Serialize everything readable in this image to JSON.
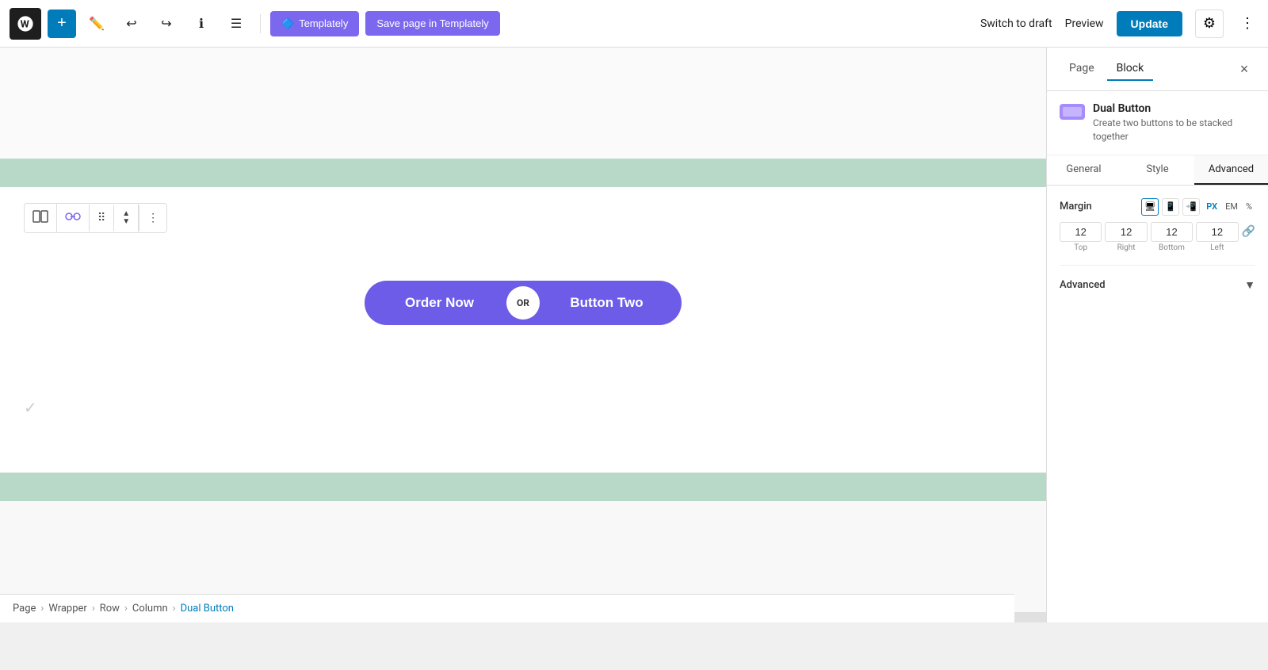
{
  "toolbar": {
    "add_label": "+",
    "templately_label": "Templately",
    "save_templately_label": "Save page in Templately",
    "switch_draft_label": "Switch to draft",
    "preview_label": "Preview",
    "update_label": "Update"
  },
  "block_toolbar": {
    "parent_icon": "⊞",
    "link_icon": "⛓",
    "drag_icon": "⠿",
    "arrows": "⇅",
    "more_icon": "⋮"
  },
  "dual_button": {
    "left_label": "Order Now",
    "separator_label": "OR",
    "right_label": "Button Two"
  },
  "breadcrumb": {
    "items": [
      "Page",
      "Wrapper",
      "Row",
      "Column",
      "Dual Button"
    ],
    "separators": [
      ">",
      ">",
      ">",
      ">"
    ]
  },
  "right_panel": {
    "tabs": [
      "Page",
      "Block"
    ],
    "active_tab": "Block",
    "close_label": "×",
    "block_name": "Dual Button",
    "block_desc": "Create two buttons to be stacked together",
    "sub_tabs": [
      "General",
      "Style",
      "Advanced"
    ],
    "active_sub_tab": "Advanced",
    "margin": {
      "label": "Margin",
      "units": [
        "PX",
        "EM",
        "%"
      ],
      "active_unit": "PX",
      "devices": [
        "desktop",
        "tablet",
        "mobile"
      ],
      "top": "12",
      "right": "12",
      "bottom": "12",
      "left": "12",
      "labels": [
        "Top",
        "Right",
        "Bottom",
        "Left"
      ]
    },
    "advanced_label": "Advanced"
  }
}
